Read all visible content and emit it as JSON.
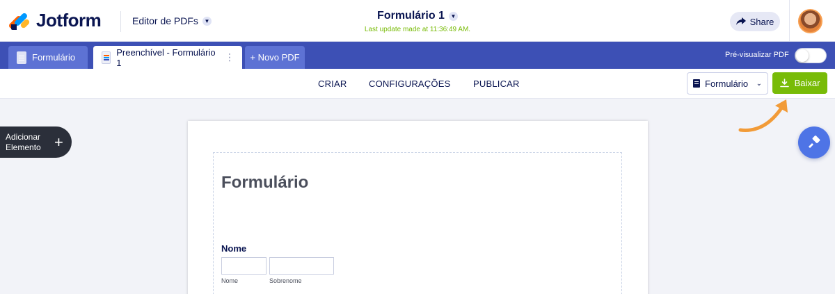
{
  "header": {
    "logo_text": "Jotform",
    "editor_label": "Editor de PDFs",
    "form_title": "Formulário 1",
    "last_update": "Last update made at 11:36:49 AM.",
    "share_label": "Share"
  },
  "tabs": {
    "form_label": "Formulário",
    "pdf_label": "Preenchível - Formulário 1",
    "new_pdf_label": "+ Novo PDF",
    "preview_label": "Pré-visualizar PDF",
    "preview_enabled": false
  },
  "nav": {
    "criar": "CRIAR",
    "config": "CONFIGURAÇÕES",
    "publicar": "PUBLICAR",
    "form_select_value": "Formulário",
    "download_label": "Baixar"
  },
  "sidebar": {
    "add_element_label": "Adicionar Elemento"
  },
  "document": {
    "title": "Formulário",
    "field_label": "Nome",
    "first_sublabel": "Nome",
    "last_sublabel": "Sobrenome"
  },
  "colors": {
    "brand_navy": "#0a1551",
    "tab_bar_blue": "#3d50b5",
    "download_green": "#78bb07",
    "annotation_orange": "#f29b38"
  }
}
